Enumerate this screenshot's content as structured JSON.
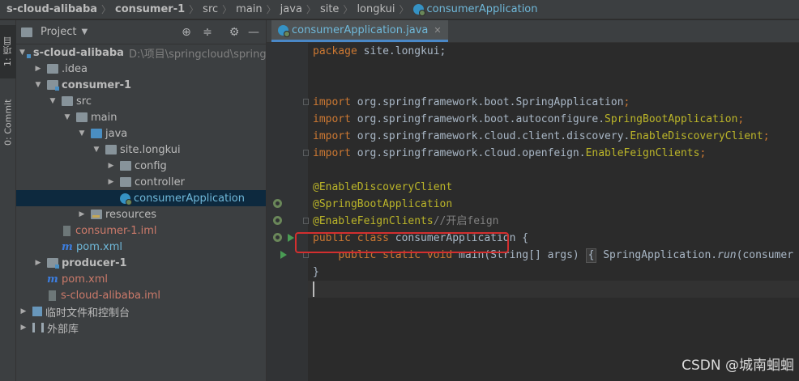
{
  "breadcrumb": [
    "s-cloud-alibaba",
    "consumer-1",
    "src",
    "main",
    "java",
    "site",
    "longkui",
    "consumerApplication"
  ],
  "tool_strip": {
    "project_tab": "1: 项目",
    "commit_tab": "0: Commit"
  },
  "project_panel": {
    "title": "Project",
    "tree": [
      {
        "label": "s-cloud-alibaba",
        "extra": "D:\\项目\\springcloud\\springclo"
      },
      {
        "label": ".idea"
      },
      {
        "label": "consumer-1"
      },
      {
        "label": "src"
      },
      {
        "label": "main"
      },
      {
        "label": "java"
      },
      {
        "label": "site.longkui"
      },
      {
        "label": "config"
      },
      {
        "label": "controller"
      },
      {
        "label": "consumerApplication"
      },
      {
        "label": "resources"
      },
      {
        "label": "consumer-1.iml"
      },
      {
        "label": "pom.xml"
      },
      {
        "label": "producer-1"
      },
      {
        "label": "pom.xml"
      },
      {
        "label": "s-cloud-alibaba.iml"
      },
      {
        "label": "临时文件和控制台"
      },
      {
        "label": "外部库"
      }
    ]
  },
  "editor": {
    "tab_label": "consumerApplication.java",
    "code": {
      "l1_kw": "package",
      "l1_rest": " site.longkui;",
      "i1_kw": "import",
      "i1_pkg": " org.springframework.boot.",
      "i1_cls": "SpringApplication",
      "i1_end": ";",
      "i2_kw": "import",
      "i2_pkg": " org.springframework.boot.autoconfigure.",
      "i2_cls": "SpringBootApplication",
      "i2_end": ";",
      "i3_kw": "import",
      "i3_pkg": " org.springframework.cloud.client.discovery.",
      "i3_cls": "EnableDiscoveryClient",
      "i3_end": ";",
      "i4_kw": "import",
      "i4_pkg": " org.springframework.cloud.openfeign.",
      "i4_cls": "EnableFeignClients",
      "i4_end": ";",
      "a1": "@EnableDiscoveryClient",
      "a2": "@SpringBootApplication",
      "a3": "@EnableFeignClients",
      "a3_comment": "//开启feign",
      "c1_kw": "public class",
      "c1_rest": " consumerApplication {",
      "m_kw": "public static void",
      "m_rest": " main(String[] args) ",
      "m_fold": "{",
      "m_call": " SpringApplication.",
      "m_run": "run",
      "m_tail": "(consumer",
      "close": "}"
    }
  },
  "watermark": "CSDN @城南蛔蛔"
}
